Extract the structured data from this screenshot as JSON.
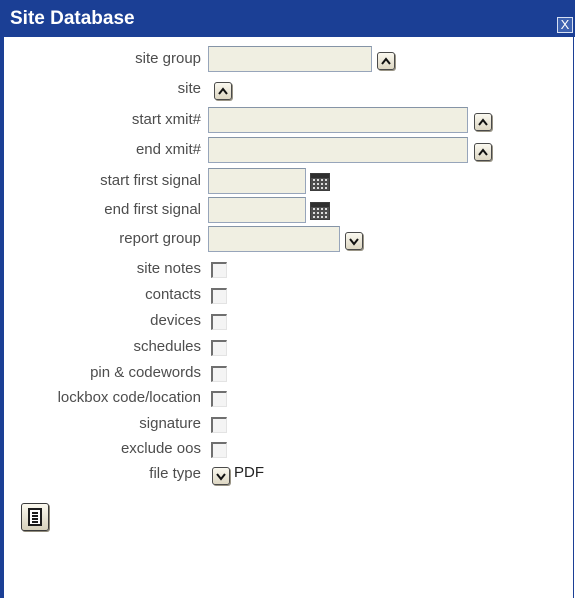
{
  "window": {
    "title": "Site Database",
    "close_label": "X"
  },
  "fields": {
    "site_group": {
      "label": "site group",
      "value": ""
    },
    "site": {
      "label": "site"
    },
    "start_xmit": {
      "label": "start xmit#",
      "value": ""
    },
    "end_xmit": {
      "label": "end xmit#",
      "value": ""
    },
    "start_first_signal": {
      "label": "start first signal",
      "value": ""
    },
    "end_first_signal": {
      "label": "end first signal",
      "value": ""
    },
    "report_group": {
      "label": "report group",
      "value": ""
    }
  },
  "options": [
    {
      "label": "site notes",
      "checked": false
    },
    {
      "label": "contacts",
      "checked": false
    },
    {
      "label": "devices",
      "checked": false
    },
    {
      "label": "schedules",
      "checked": false
    },
    {
      "label": "pin & codewords",
      "checked": false
    },
    {
      "label": "lockbox code/location",
      "checked": false
    },
    {
      "label": "signature",
      "checked": false
    },
    {
      "label": "exclude oos",
      "checked": false
    }
  ],
  "file_type": {
    "label": "file type",
    "value": "PDF"
  },
  "icons": {
    "lookup": "caret-up-icon",
    "calendar": "calendar-icon",
    "dropdown": "chevron-down-icon",
    "report": "document-list-icon",
    "close": "close-icon"
  },
  "colors": {
    "titlebar": "#1b3f95",
    "field_bg": "#f0efe2",
    "label_text": "#4d4d4d"
  }
}
